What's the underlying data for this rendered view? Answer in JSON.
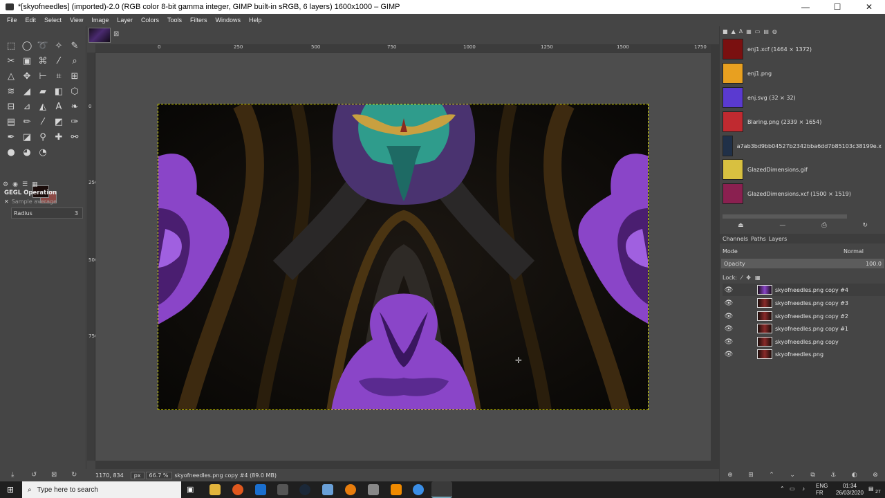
{
  "window": {
    "title": "*[skyofneedles] (imported)-2.0 (RGB color 8-bit gamma integer, GIMP built-in sRGB, 6 layers) 1600x1000 – GIMP",
    "minimize": "—",
    "maximize": "☐",
    "close": "✕"
  },
  "menu": [
    "File",
    "Edit",
    "Select",
    "View",
    "Image",
    "Layer",
    "Colors",
    "Tools",
    "Filters",
    "Windows",
    "Help"
  ],
  "tool_options": {
    "title": "GEGL Operation",
    "sample": "Sample average",
    "radius_label": "Radius",
    "radius_value": "3"
  },
  "ruler": {
    "h_ticks": [
      "0",
      "250",
      "500",
      "750",
      "1000",
      "1250",
      "1500",
      "1750"
    ],
    "v_ticks": [
      "0",
      "250",
      "500",
      "750"
    ]
  },
  "status": {
    "coords": "1170, 834",
    "unit": "px",
    "zoom": "66.7 %",
    "layer_info": "skyofneedles.png copy #4 (89.0 MB)"
  },
  "images_panel": [
    {
      "label": "enj1.xcf (1464 × 1372)",
      "thumb_color": "#7a1010"
    },
    {
      "label": "enj1.png",
      "thumb_color": "#e8a020"
    },
    {
      "label": "enj.svg (32 × 32)",
      "thumb_color": "#5a3ad0"
    },
    {
      "label": "Blaring.png (2339 × 1654)",
      "thumb_color": "#c02a30"
    },
    {
      "label": "a7ab3bd9bb04527b2342bba6dd7b85103c38199e.x",
      "thumb_color": "#203048"
    },
    {
      "label": "GlazedDimensions.gif",
      "thumb_color": "#d8c040"
    },
    {
      "label": "GlazedDimensions.xcf (1500 × 1519)",
      "thumb_color": "#8a2050"
    }
  ],
  "layers_tabs": {
    "channels": "Channels",
    "paths": "Paths",
    "layers": "Layers"
  },
  "layers_dock": {
    "mode_label": "Mode",
    "mode_value": "Normal",
    "opacity_label": "Opacity",
    "opacity_value": "100.0",
    "lock_label": "Lock:"
  },
  "layers": [
    "skyofneedles.png copy #4",
    "skyofneedles.png copy #3",
    "skyofneedles.png copy #2",
    "skyofneedles.png copy #1",
    "skyofneedles.png copy",
    "skyofneedles.png"
  ],
  "taskbar": {
    "search_placeholder": "Type here to search",
    "lang": "ENG",
    "region": "FR",
    "time": "01:34",
    "date": "26/03/2020",
    "notif": "27"
  }
}
